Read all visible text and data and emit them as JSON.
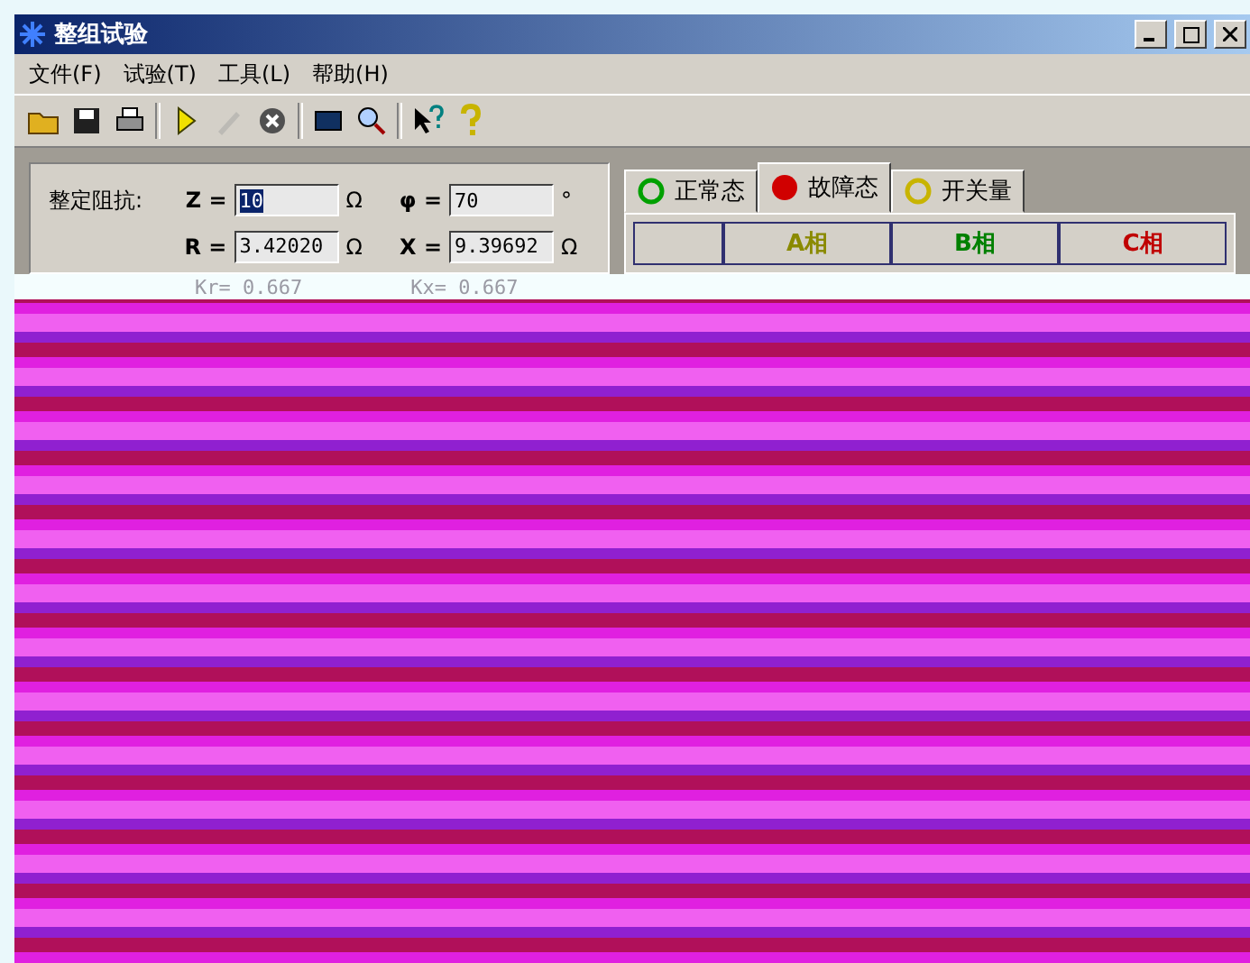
{
  "window": {
    "title": "整组试验"
  },
  "menu": [
    {
      "label": "文件(F)"
    },
    {
      "label": "试验(T)"
    },
    {
      "label": "工具(L)"
    },
    {
      "label": "帮助(H)"
    }
  ],
  "toolbar": [
    {
      "kind": "open"
    },
    {
      "kind": "save"
    },
    {
      "kind": "print"
    },
    {
      "kind": "sep"
    },
    {
      "kind": "play"
    },
    {
      "kind": "pen",
      "disabled": true
    },
    {
      "kind": "stop"
    },
    {
      "kind": "sep"
    },
    {
      "kind": "monitor"
    },
    {
      "kind": "zoom"
    },
    {
      "kind": "sep"
    },
    {
      "kind": "whatsthis"
    },
    {
      "kind": "help"
    }
  ],
  "impedance": {
    "label": "整定阻抗:",
    "fields": [
      {
        "name": "Z =",
        "value": "10",
        "unit": "Ω",
        "selected": true
      },
      {
        "name": "φ =",
        "value": "70",
        "unit": "°",
        "selected": false
      },
      {
        "name": "R =",
        "value": "3.42020",
        "unit": "Ω",
        "selected": false
      },
      {
        "name": "X =",
        "value": "9.39692",
        "unit": "Ω",
        "selected": false
      }
    ],
    "coefficients": [
      "Kr= 0.667",
      "Kx= 0.667"
    ]
  },
  "tabs": [
    {
      "label": "正常态",
      "kind": "ring",
      "color": "#00a000",
      "selected": false
    },
    {
      "label": "故障态",
      "kind": "dot",
      "color": "#d00000",
      "selected": true
    },
    {
      "label": "开关量",
      "kind": "ring",
      "color": "#c8b400",
      "selected": false
    }
  ],
  "table": {
    "columns": [
      {
        "label": "A相",
        "color": "#8a8a00"
      },
      {
        "label": "B相",
        "color": "#008000"
      },
      {
        "label": "C相",
        "color": "#c00000"
      }
    ]
  }
}
